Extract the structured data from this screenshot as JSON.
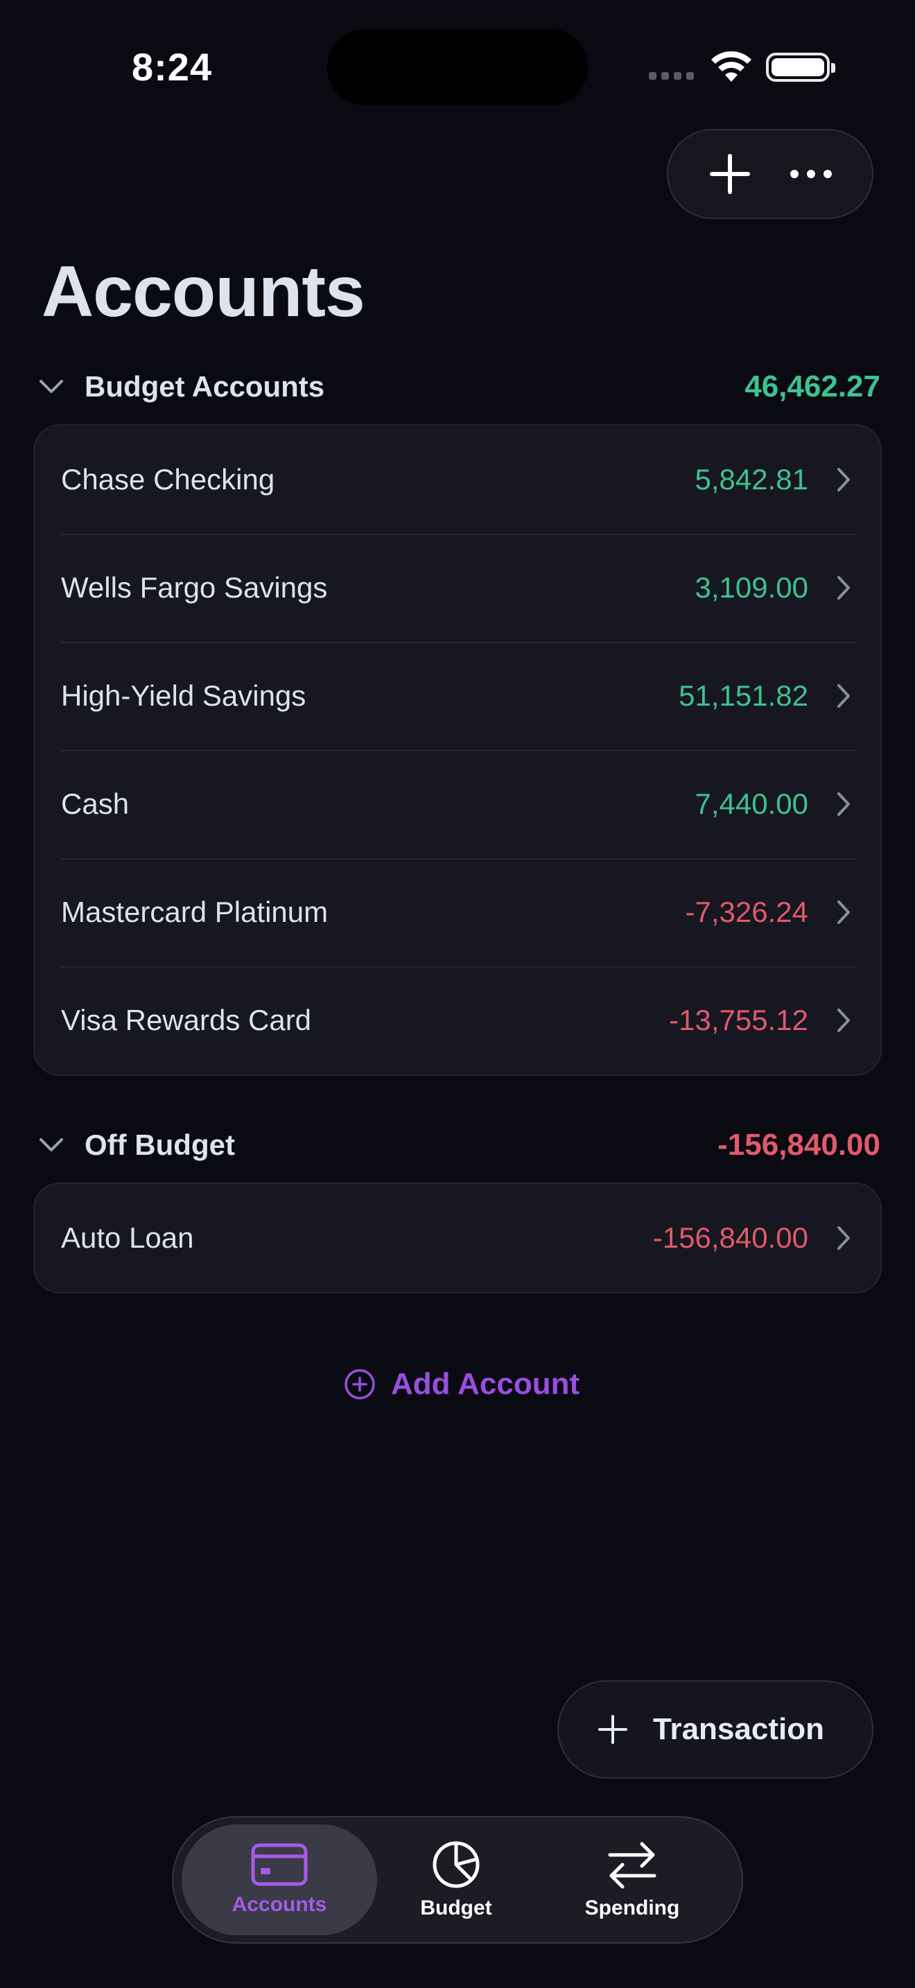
{
  "status_bar": {
    "time": "8:24"
  },
  "page": {
    "title": "Accounts"
  },
  "budget_section": {
    "label": "Budget Accounts",
    "total": "46,462.27",
    "accounts": [
      {
        "name": "Chase Checking",
        "amount": "5,842.81"
      },
      {
        "name": "Wells Fargo Savings",
        "amount": "3,109.00"
      },
      {
        "name": "High-Yield Savings",
        "amount": "51,151.82"
      },
      {
        "name": "Cash",
        "amount": "7,440.00"
      },
      {
        "name": "Mastercard Platinum",
        "amount": "-7,326.24"
      },
      {
        "name": "Visa Rewards Card",
        "amount": "-13,755.12"
      }
    ]
  },
  "off_budget_section": {
    "label": "Off Budget",
    "total": "-156,840.00",
    "accounts": [
      {
        "name": "Auto Loan",
        "amount": "-156,840.00"
      }
    ]
  },
  "add_account": {
    "label": "Add Account"
  },
  "transaction_button": {
    "label": "Transaction"
  },
  "tabbar": {
    "tabs": [
      {
        "label": "Accounts",
        "icon": "credit-card-icon",
        "active": true
      },
      {
        "label": "Budget",
        "icon": "pie-chart-icon",
        "active": false
      },
      {
        "label": "Spending",
        "icon": "arrows-swap-icon",
        "active": false
      }
    ]
  },
  "colors": {
    "background": "#0a0a12",
    "positive": "#3ec28f",
    "negative": "#e05a6c",
    "accent": "#9b4de0"
  }
}
